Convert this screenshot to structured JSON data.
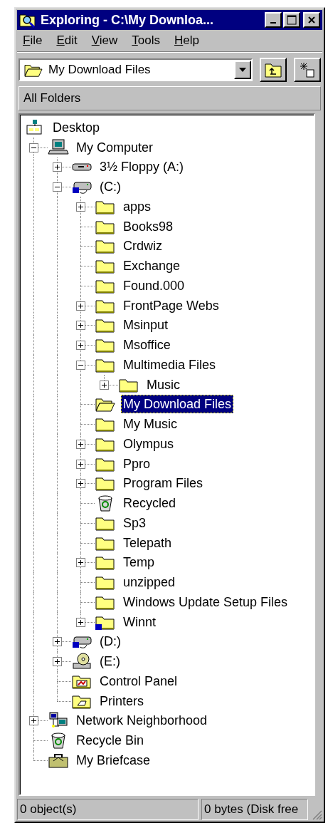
{
  "window": {
    "title": "Exploring - C:\\My Downloa..."
  },
  "menu": [
    {
      "label": "File"
    },
    {
      "label": "Edit"
    },
    {
      "label": "View"
    },
    {
      "label": "Tools"
    },
    {
      "label": "Help"
    }
  ],
  "address": {
    "value": "My Download Files"
  },
  "pane": {
    "title": "All Folders"
  },
  "tree": [
    {
      "label": "Desktop",
      "kind": "desktop",
      "selected": false,
      "children": [
        {
          "label": "My Computer",
          "kind": "computer",
          "selected": false,
          "expanded": true,
          "children": [
            {
              "label": "3½ Floppy (A:)",
              "kind": "floppy",
              "selected": false,
              "expanded": false
            },
            {
              "label": "(C:)",
              "kind": "drive",
              "selected": false,
              "expanded": true,
              "children": [
                {
                  "label": "apps",
                  "kind": "folder",
                  "selected": false,
                  "expanded": false
                },
                {
                  "label": "Books98",
                  "kind": "folder",
                  "selected": false
                },
                {
                  "label": "Crdwiz",
                  "kind": "folder",
                  "selected": false
                },
                {
                  "label": "Exchange",
                  "kind": "folder",
                  "selected": false
                },
                {
                  "label": "Found.000",
                  "kind": "folder",
                  "selected": false
                },
                {
                  "label": "FrontPage Webs",
                  "kind": "folder",
                  "selected": false,
                  "expanded": false
                },
                {
                  "label": "Msinput",
                  "kind": "folder",
                  "selected": false,
                  "expanded": false
                },
                {
                  "label": "Msoffice",
                  "kind": "folder",
                  "selected": false,
                  "expanded": false
                },
                {
                  "label": "Multimedia Files",
                  "kind": "folder",
                  "selected": false,
                  "expanded": true,
                  "children": [
                    {
                      "label": "Music",
                      "kind": "folder",
                      "selected": false,
                      "expanded": false
                    }
                  ]
                },
                {
                  "label": "My Download Files",
                  "kind": "open-folder",
                  "selected": true
                },
                {
                  "label": "My Music",
                  "kind": "folder",
                  "selected": false
                },
                {
                  "label": "Olympus",
                  "kind": "folder",
                  "selected": false,
                  "expanded": false
                },
                {
                  "label": "Ppro",
                  "kind": "folder",
                  "selected": false,
                  "expanded": false
                },
                {
                  "label": "Program Files",
                  "kind": "folder",
                  "selected": false,
                  "expanded": false
                },
                {
                  "label": "Recycled",
                  "kind": "recycle",
                  "selected": false
                },
                {
                  "label": "Sp3",
                  "kind": "folder",
                  "selected": false
                },
                {
                  "label": "Telepath",
                  "kind": "folder",
                  "selected": false
                },
                {
                  "label": "Temp",
                  "kind": "folder",
                  "selected": false,
                  "expanded": false
                },
                {
                  "label": "unzipped",
                  "kind": "folder",
                  "selected": false
                },
                {
                  "label": "Windows Update Setup Files",
                  "kind": "folder",
                  "selected": false
                },
                {
                  "label": "Winnt",
                  "kind": "shared-folder",
                  "selected": false,
                  "expanded": false
                }
              ]
            },
            {
              "label": "(D:)",
              "kind": "drive",
              "selected": false,
              "expanded": false
            },
            {
              "label": "(E:)",
              "kind": "cd",
              "selected": false,
              "expanded": false
            },
            {
              "label": "Control Panel",
              "kind": "control-panel",
              "selected": false
            },
            {
              "label": "Printers",
              "kind": "printers",
              "selected": false
            }
          ]
        },
        {
          "label": "Network Neighborhood",
          "kind": "network",
          "selected": false,
          "expanded": false
        },
        {
          "label": "Recycle Bin",
          "kind": "recycle",
          "selected": false
        },
        {
          "label": "My Briefcase",
          "kind": "briefcase",
          "selected": false
        }
      ]
    }
  ],
  "status_bar": [
    {
      "text": "0 object(s)"
    },
    {
      "text": "0 bytes (Disk free"
    }
  ]
}
